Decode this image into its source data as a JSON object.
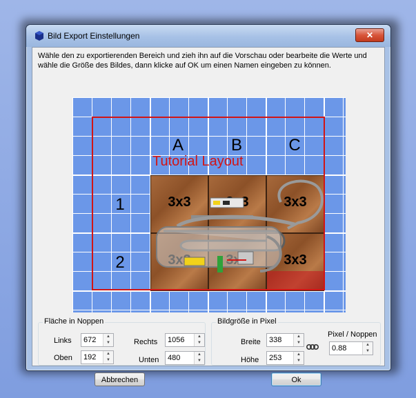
{
  "window": {
    "title": "Bild Export Einstellungen",
    "close_label": "✕"
  },
  "description": "Wähle den zu exportierenden Bereich und zieh ihn auf die Vorschau oder bearbeite die Werte und wähle die Größe des Bildes, dann klicke auf OK um einen Namen eingeben zu können.",
  "preview": {
    "layout_title": "Tutorial Layout",
    "columns": [
      "A",
      "B",
      "C"
    ],
    "rows": [
      "1",
      "2"
    ],
    "tiles": [
      "3x3",
      "3x3",
      "3x3",
      "3x3",
      "3x3",
      "3x3"
    ]
  },
  "area_group": {
    "title": "Fläche in Noppen",
    "left_label": "Links",
    "left_value": "672",
    "top_label": "Oben",
    "top_value": "192",
    "right_label": "Rechts",
    "right_value": "1056",
    "bottom_label": "Unten",
    "bottom_value": "480"
  },
  "size_group": {
    "title": "Bildgröße in Pixel",
    "width_label": "Breite",
    "width_value": "338",
    "height_label": "Höhe",
    "height_value": "253",
    "ratio_label": "Pixel / Noppen",
    "ratio_value": "0.88"
  },
  "buttons": {
    "cancel": "Abbrechen",
    "ok": "Ok"
  },
  "colors": {
    "preview_background": "#6b97e8",
    "selection_border": "#d21414",
    "tile": "#9a5d32"
  }
}
